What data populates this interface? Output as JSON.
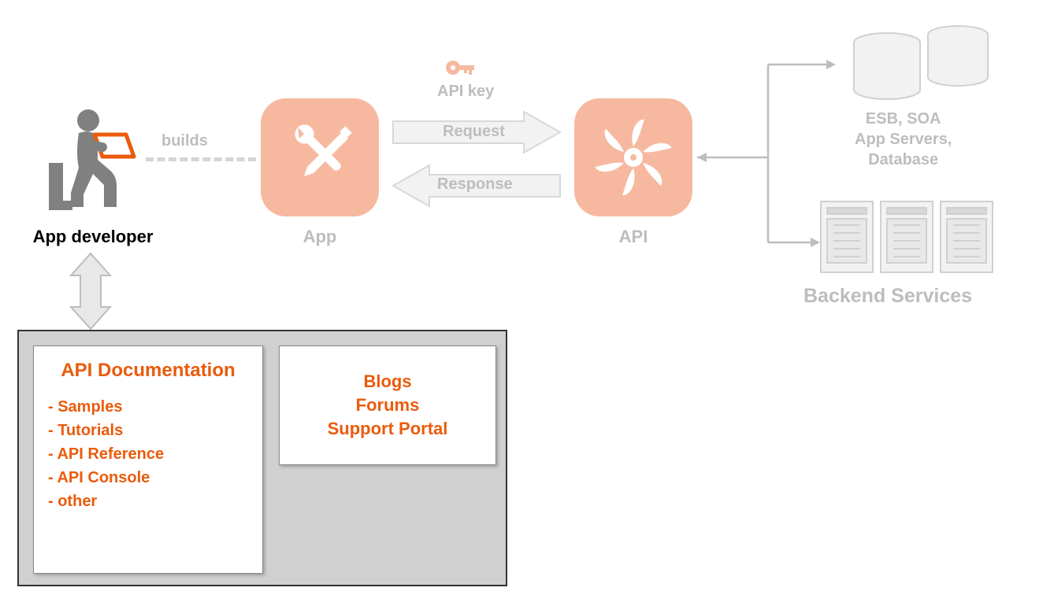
{
  "developer": {
    "label": "App developer"
  },
  "builds": {
    "label": "builds"
  },
  "app": {
    "label": "App"
  },
  "api": {
    "label": "API"
  },
  "apiKey": {
    "label": "API key"
  },
  "request": {
    "label": "Request"
  },
  "response": {
    "label": "Response"
  },
  "backend": {
    "label": "Backend Services",
    "top": {
      "line1": "ESB, SOA",
      "line2": "App Servers,",
      "line3": "Database"
    }
  },
  "portal": {
    "card1": {
      "title": "API Documentation",
      "items": [
        "Samples",
        "Tutorials",
        "API Reference",
        "API Console",
        "other"
      ]
    },
    "card2": {
      "lines": [
        "Blogs",
        "Forums",
        "Support Portal"
      ]
    }
  },
  "colors": {
    "accent": "#ea5b0c",
    "fadedIcon": "#f6b9a0",
    "gray": "#bdbdbd"
  }
}
